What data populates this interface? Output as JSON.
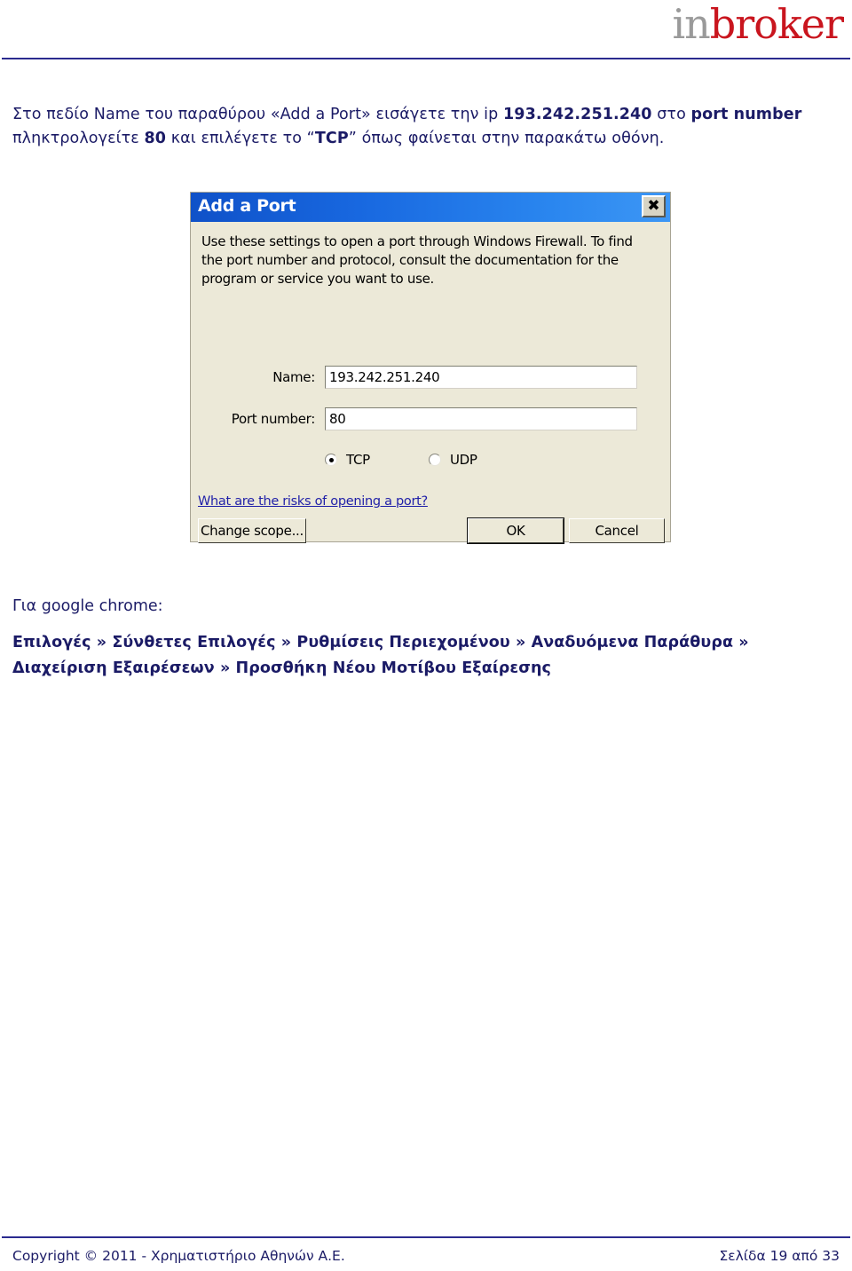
{
  "header": {
    "logo_first": "in",
    "logo_second": "broker",
    "logo_color_first": "#9a9a9a",
    "logo_color_second": "#c9151e",
    "rule_color": "#2b2b8f"
  },
  "intro": {
    "part1": "Στο πεδίο Name του παραθύρου «Add a Port» εισάγετε την ip ",
    "ip_bold": "193.242.251.240",
    "part2": " στο ",
    "port_number_bold": "port number",
    "part3": " πληκτρολογείτε ",
    "port_bold": "80",
    "part4": " και επιλέγετε το “",
    "tcp_bold": "TCP",
    "part5": "” όπως φαίνεται στην παρακάτω οθόνη."
  },
  "dialog": {
    "title": "Add a Port",
    "close_icon": "close-icon",
    "close_glyph": "✖",
    "description": "Use these settings to open a port through Windows Firewall. To find the port number and protocol, consult the documentation for the program or service you want to use.",
    "fields": [
      {
        "label": "Name:",
        "value": "193.242.251.240"
      },
      {
        "label": "Port number:",
        "value": "80"
      }
    ],
    "protocols": [
      {
        "label": "TCP",
        "selected": true
      },
      {
        "label": "UDP",
        "selected": false
      }
    ],
    "risk_link": "What are the risks of opening a port?",
    "buttons": {
      "change_scope": "Change scope...",
      "ok": "OK",
      "cancel": "Cancel"
    },
    "titlebar_color": "#1868e0",
    "body_color": "#ece9d8"
  },
  "chrome": {
    "intro": "Για google chrome:",
    "path_line1": "Επιλογές » Σύνθετες Επιλογές » Ρυθμίσεις Περιεχομένου » Αναδυόμενα Παράθυρα »",
    "path_line2": "Διαχείριση Εξαιρέσεων » Προσθήκη Νέου Μοτίβου Εξαίρεσης"
  },
  "footer": {
    "copyright": "Copyright © 2011 - Χρηματιστήριο Αθηνών Α.Ε.",
    "page": "Σελίδα 19 από 33"
  }
}
